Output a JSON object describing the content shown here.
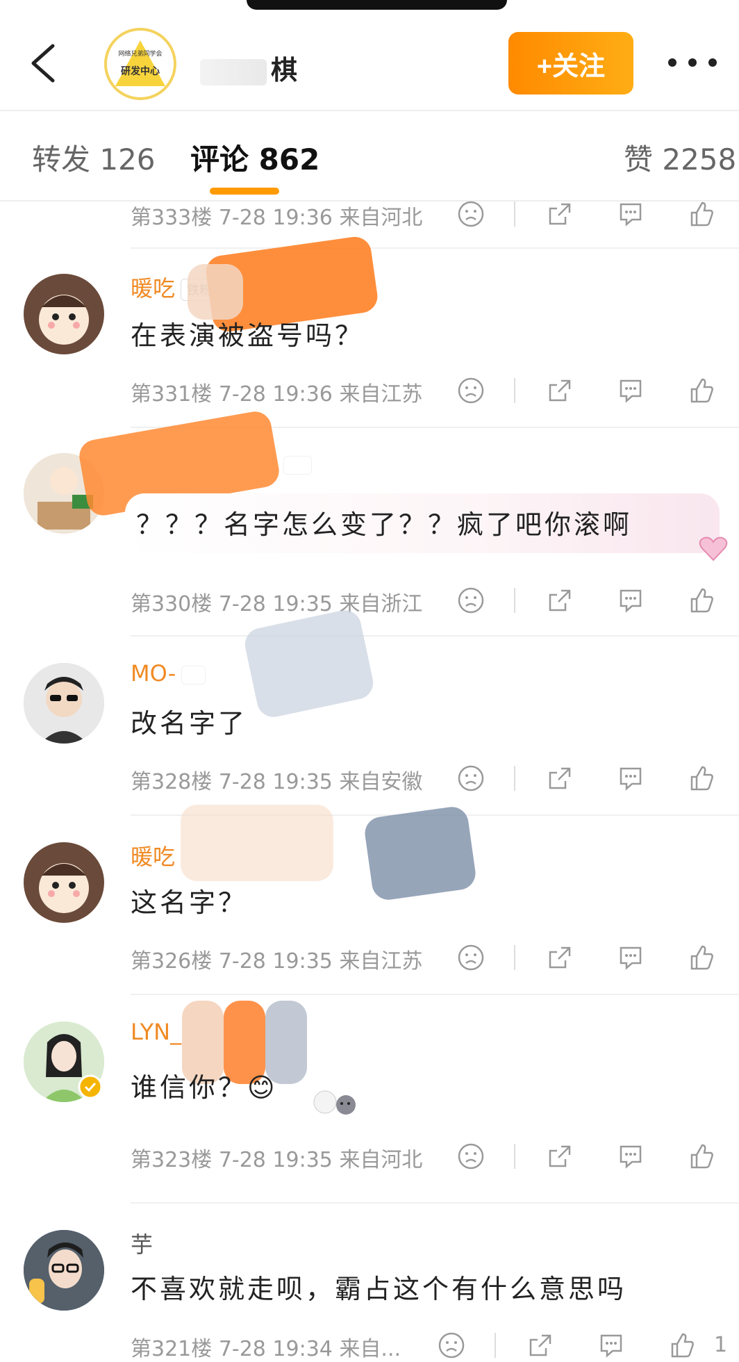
{
  "header": {
    "back_icon": "chevron-left-icon",
    "logo_text": "研发中心",
    "logo_small": "网络兄弟同学会",
    "account_name": "棋",
    "follow_label": "+关注",
    "more_icon": "more-dots-icon"
  },
  "tabs": [
    {
      "label": "转发 126",
      "active": false
    },
    {
      "label": "评论 862",
      "active": true
    },
    {
      "label": "赞 2258",
      "active": false
    }
  ],
  "accent_color": "#FF9A00",
  "comments": [
    {
      "name": "",
      "tag": "",
      "text": "",
      "floor": "第333楼",
      "time": "7-28 19:36",
      "location": "来自河北"
    },
    {
      "name": "暖吃",
      "tag": "铁粉",
      "text": "在表演被盗号吗？",
      "floor": "第331楼",
      "time": "7-28 19:36",
      "location": "来自江苏"
    },
    {
      "name": "",
      "tag": "",
      "text": "？？？名字怎么变了？？疯了吧你滚啊",
      "floor": "第330楼",
      "time": "7-28 19:35",
      "location": "来自浙江"
    },
    {
      "name": "MO-",
      "tag": "",
      "text": "改名字了",
      "floor": "第328楼",
      "time": "7-28 19:35",
      "location": "来自安徽"
    },
    {
      "name": "暖吃",
      "tag": "",
      "text": "这名字？",
      "floor": "第326楼",
      "time": "7-28 19:35",
      "location": "来自江苏"
    },
    {
      "name": "LYN_",
      "tag": "",
      "text": "谁信你？😊",
      "floor": "第323楼",
      "time": "7-28 19:35",
      "location": "来自河北"
    },
    {
      "name": "芋",
      "tag": "",
      "text": "不喜欢就走呗，霸占这个有什么意思吗",
      "floor": "第321楼",
      "time": "7-28 19:34",
      "location": "来自...",
      "likes": "1"
    }
  ],
  "icons": [
    "sad-face-icon",
    "share-icon",
    "comment-icon",
    "thumbs-up-icon"
  ]
}
